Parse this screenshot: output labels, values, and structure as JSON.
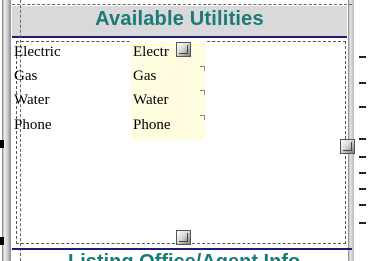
{
  "header": {
    "title": "Available Utilities"
  },
  "rows": [
    {
      "label": "Electric",
      "value": "Electr"
    },
    {
      "label": "Gas",
      "value": "Gas"
    },
    {
      "label": "Water",
      "value": "Water"
    },
    {
      "label": "Phone",
      "value": "Phone"
    }
  ],
  "next_section": {
    "title_fragment": "Listing Office/Agent Info"
  },
  "colors": {
    "title": "#1a7a7a",
    "rule": "#1c1c78",
    "value_highlight": "#fffce0",
    "header_band": "#d9d9d9"
  }
}
